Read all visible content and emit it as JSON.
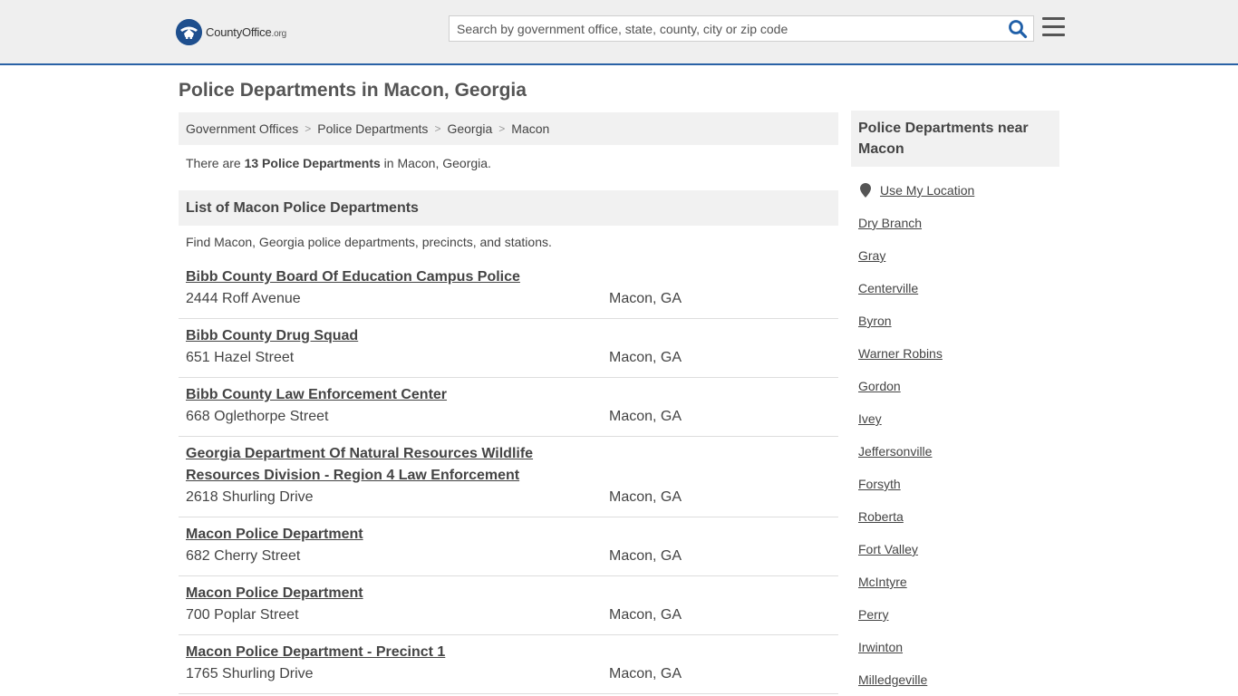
{
  "header": {
    "logo_text": "CountyOffice",
    "logo_suffix": ".org",
    "search_placeholder": "Search by government office, state, county, city or zip code"
  },
  "page": {
    "title": "Police Departments in Macon, Georgia"
  },
  "breadcrumb": [
    "Government Offices",
    "Police Departments",
    "Georgia",
    "Macon"
  ],
  "intro": {
    "prefix": "There are ",
    "count_text": "13 Police Departments",
    "suffix": " in Macon, Georgia."
  },
  "list": {
    "heading": "List of Macon Police Departments",
    "description": "Find Macon, Georgia police departments, precincts, and stations.",
    "items": [
      {
        "name": "Bibb County Board Of Education Campus Police",
        "address": "2444 Roff Avenue",
        "city": "Macon, GA"
      },
      {
        "name": "Bibb County Drug Squad",
        "address": "651 Hazel Street",
        "city": "Macon, GA"
      },
      {
        "name": "Bibb County Law Enforcement Center",
        "address": "668 Oglethorpe Street",
        "city": "Macon, GA"
      },
      {
        "name": "Georgia Department Of Natural Resources Wildlife Resources Division - Region 4 Law Enforcement",
        "address": "2618 Shurling Drive",
        "city": "Macon, GA"
      },
      {
        "name": "Macon Police Department",
        "address": "682 Cherry Street",
        "city": "Macon, GA"
      },
      {
        "name": "Macon Police Department",
        "address": "700 Poplar Street",
        "city": "Macon, GA"
      },
      {
        "name": "Macon Police Department - Precinct 1",
        "address": "1765 Shurling Drive",
        "city": "Macon, GA"
      }
    ]
  },
  "sidebar": {
    "heading": "Police Departments near Macon",
    "use_location": "Use My Location",
    "links": [
      "Dry Branch",
      "Gray",
      "Centerville",
      "Byron",
      "Warner Robins",
      "Gordon",
      "Ivey",
      "Jeffersonville",
      "Forsyth",
      "Roberta",
      "Fort Valley",
      "McIntyre",
      "Perry",
      "Irwinton",
      "Milledgeville"
    ]
  },
  "colors": {
    "header_bg": "#efefef",
    "accent_blue": "#2a62a6",
    "panel_bg": "#f1f1f1",
    "text": "#444444"
  },
  "icons": [
    "county-office-logo-icon",
    "search-icon",
    "hamburger-menu-icon",
    "location-pin-icon"
  ]
}
